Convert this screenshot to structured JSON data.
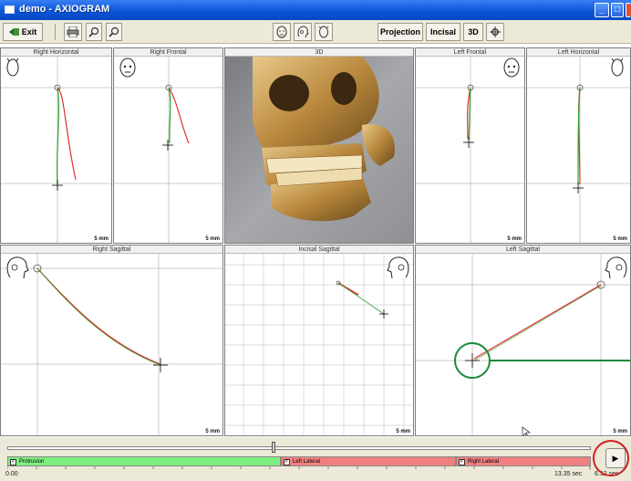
{
  "window": {
    "title": "demo - AXIOGRAM",
    "min_glyph": "_",
    "max_glyph": "□",
    "close_glyph": "×"
  },
  "toolbar": {
    "exit_label": "Exit",
    "exit_icon": "exit-icon",
    "print_icon": "printer-icon",
    "zoom_in_icon": "zoom-in-icon",
    "zoom_out_icon": "zoom-out-icon",
    "view_buttons": [
      "Projection",
      "Incisal",
      "3D"
    ],
    "settings_icon": "gear-icon"
  },
  "panels": {
    "right_horizontal": {
      "title": "Right Horizontal",
      "scale": "5 mm"
    },
    "right_frontal": {
      "title": "Right Frontal",
      "scale": "5 mm"
    },
    "view_3d": {
      "title": "3D"
    },
    "left_frontal": {
      "title": "Left Frontal",
      "scale": "5 mm"
    },
    "left_horizontal": {
      "title": "Left Horizontal",
      "scale": "5 mm"
    },
    "right_sagittal": {
      "title": "Right Sagittal",
      "scale": "5 mm"
    },
    "incisal_sagittal": {
      "title": "Incisal Sagittal",
      "scale": "5 mm"
    },
    "left_sagittal": {
      "title": "Left Sagittal",
      "scale": "5 mm"
    }
  },
  "timeline": {
    "segments": [
      {
        "label": "Protrusion",
        "color": "#7fef7f"
      },
      {
        "label": "Left Lateral",
        "color": "#f08080"
      },
      {
        "label": "Right Lateral",
        "color": "#f08080"
      }
    ],
    "start_time": "0.00",
    "end_time": "13.35 sec",
    "end_time_2": "6.12 sec",
    "play_glyph": "▶"
  },
  "colors": {
    "green_trace": "#2aa02a",
    "red_trace": "#e03030",
    "highlight_green": "#1a8a3a",
    "highlight_red": "#d02020"
  }
}
